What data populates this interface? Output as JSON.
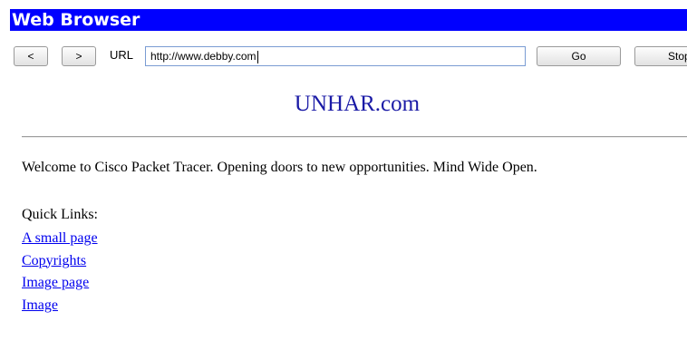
{
  "window": {
    "title": "Web Browser"
  },
  "toolbar": {
    "back_label": "<",
    "forward_label": ">",
    "url_label": "URL",
    "url_value": "http://www.debby.com",
    "go_label": "Go",
    "stop_label": "Stop"
  },
  "page": {
    "site_title": "UNHAR.com",
    "welcome_text": "Welcome to Cisco Packet Tracer. Opening doors to new opportunities. Mind Wide Open.",
    "quick_links_title": "Quick Links:",
    "links": [
      "A small page",
      "Copyrights",
      "Image page",
      "Image"
    ]
  },
  "colors": {
    "titlebar_bg": "#0000ff",
    "site_title": "#1a1aa6",
    "link": "#0000ee"
  }
}
